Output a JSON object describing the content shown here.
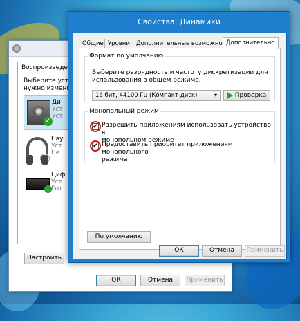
{
  "back_window": {
    "tab_label": "Воспроизведение",
    "desc_line1": "Выберите устро",
    "desc_line2": "нужно изменит",
    "devices": [
      {
        "name": "Ди",
        "line2": "Уст",
        "line3": "Уст"
      },
      {
        "name": "Нау",
        "line2": "Уст",
        "line3": "Не"
      },
      {
        "name": "Циф",
        "line2": "Уст",
        "line3": "Гот"
      }
    ],
    "configure_button": "Настроить",
    "ok_button": "ОК",
    "cancel_button": "Отмена",
    "apply_button": "Применить"
  },
  "front_window": {
    "title": "Свойства: Динамики",
    "tabs": [
      {
        "label": "Общие",
        "active": false
      },
      {
        "label": "Уровни",
        "active": false
      },
      {
        "label": "Дополнительные возможности",
        "active": false
      },
      {
        "label": "Дополнительно",
        "active": true
      }
    ],
    "default_format": {
      "legend": "Формат по умолчанию",
      "desc_line1": "Выберите разрядность и частоту дискретизации для",
      "desc_line2": "использования в общем режиме.",
      "selected": "16 бит, 44100 Гц (Компакт-диск)",
      "test_button": "Проверка"
    },
    "exclusive_mode": {
      "legend": "Монопольный режим",
      "option1_line1": "Разрешить приложениям использовать устройство в",
      "option1_line2": "монопольном режиме",
      "option1_checked": true,
      "option2_line1": "Предоставить приоритет приложениям монопольного",
      "option2_line2": "режима",
      "option2_checked": true
    },
    "restore_default_button": "По умолчанию",
    "ok_button": "ОК",
    "cancel_button": "Отмена",
    "apply_button": "Применить"
  },
  "colors": {
    "window_frame": "#1e7fcf",
    "annotation_ring": "#dd1111"
  },
  "icons": {
    "checkbox_mark": "✔",
    "dropdown_arrow": "▾",
    "default_device_check": "✓",
    "digital_down": "↓"
  }
}
